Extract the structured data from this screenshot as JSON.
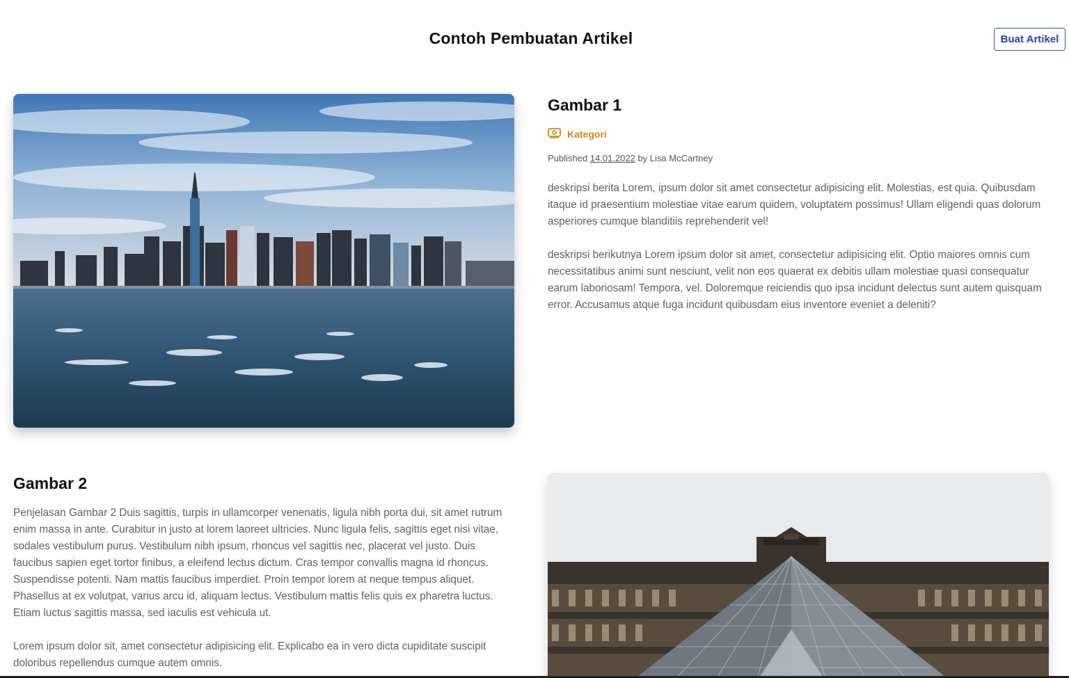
{
  "header": {
    "title": "Contoh Pembuatan Artikel",
    "create_button": "Buat Artikel"
  },
  "articles": [
    {
      "title": "Gambar 1",
      "category": "Kategori",
      "category_icon": "ticket-icon",
      "published_prefix": "Published",
      "date": "14.01.2022",
      "by": "by Lisa McCartney",
      "paragraphs": [
        "deskripsi berita Lorem, ipsum dolor sit amet consectetur adipisicing elit. Molestias, est quia. Quibusdam itaque id praesentium molestiae vitae earum quidem, voluptatem possimus! Ullam eligendi quas dolorum asperiores cumque blanditiis reprehenderit vel!",
        "deskripsi berikutnya Lorem ipsum dolor sit amet, consectetur adipisicing elit. Optio maiores omnis cum necessitatibus animi sunt nesciunt, velit non eos quaerat ex debitis ullam molestiae quasi consequatur earum laboriosam! Tempora, vel. Doloremque reiciendis quo ipsa incidunt delectus sunt autem quisquam error. Accusamus atque fuga incidunt quibusdam eius inventore eveniet a deleniti?"
      ],
      "image_subject": "city-skyline-photo"
    },
    {
      "title": "Gambar 2",
      "paragraphs": [
        "Penjelasan Gambar 2 Duis sagittis, turpis in ullamcorper venenatis, ligula nibh porta dui, sit amet rutrum enim massa in ante. Curabitur in justo at lorem laoreet ultricies. Nunc ligula felis, sagittis eget nisi vitae, sodales vestibulum purus. Vestibulum nibh ipsum, rhoncus vel sagittis nec, placerat vel justo. Duis faucibus sapien eget tortor finibus, a eleifend lectus dictum. Cras tempor convallis magna id rhoncus. Suspendisse potenti. Nam mattis faucibus imperdiet. Proin tempor lorem at neque tempus aliquet. Phasellus at ex volutpat, varius arcu id, aliquam lectus. Vestibulum mattis felis quis ex pharetra luctus. Etiam luctus sagittis massa, sed iaculis est vehicula ut.",
        "Lorem ipsum dolor sit, amet consectetur adipisicing elit. Explicabo ea in vero dicta cupiditate suscipit doloribus repellendus cumque autem omnis."
      ],
      "image_subject": "louvre-pyramid-photo"
    }
  ],
  "colors": {
    "accent": "#2c3fb3",
    "category": "#c98a14",
    "body_text": "#5f5f5f"
  }
}
